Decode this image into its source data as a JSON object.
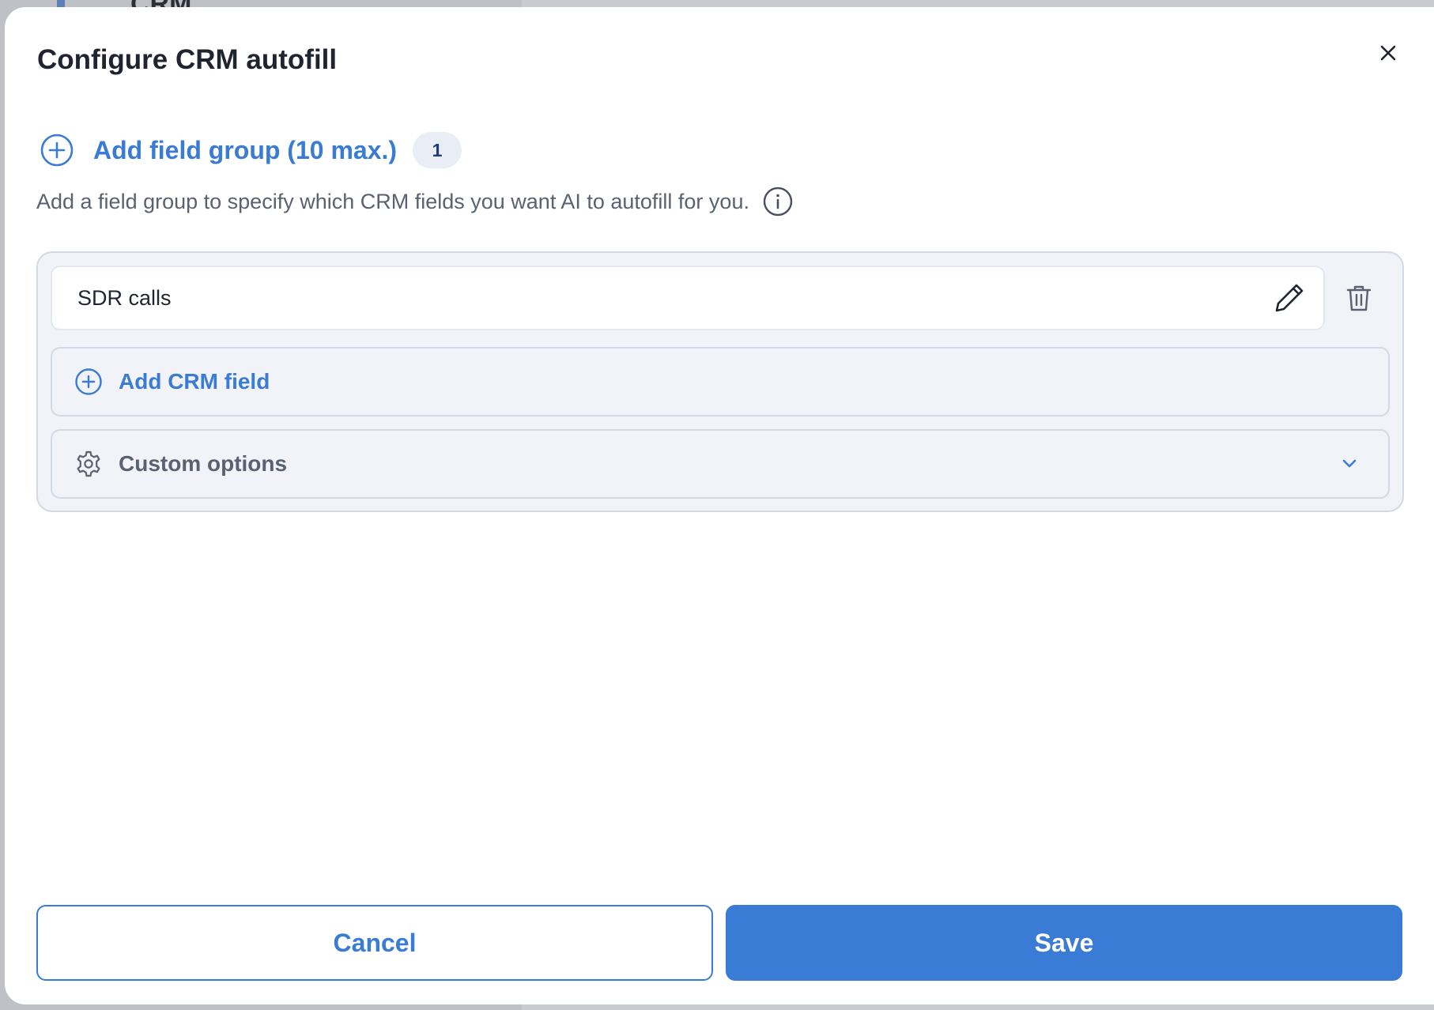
{
  "background": {
    "peek_text": "CRM"
  },
  "modal": {
    "title": "Configure CRM autofill",
    "add_group": {
      "label": "Add field group (10 max.)",
      "count": "1"
    },
    "description": "Add a field group to specify which CRM fields you want AI to autofill for you.",
    "groups": [
      {
        "name": "SDR calls",
        "add_field_label": "Add CRM field",
        "custom_options_label": "Custom options"
      }
    ],
    "footer": {
      "cancel_label": "Cancel",
      "save_label": "Save"
    }
  },
  "icons": {
    "close": "close-icon",
    "add": "plus-circle-icon",
    "info": "info-icon",
    "edit": "pencil-icon",
    "delete": "trash-icon",
    "settings": "gear-icon",
    "expand": "chevron-down-icon"
  },
  "colors": {
    "accent": "#3a7bd5",
    "title_text": "#1f2430",
    "muted_text": "#5a6170",
    "card_background": "#f1f3f8",
    "card_border": "#d3d9e6"
  }
}
